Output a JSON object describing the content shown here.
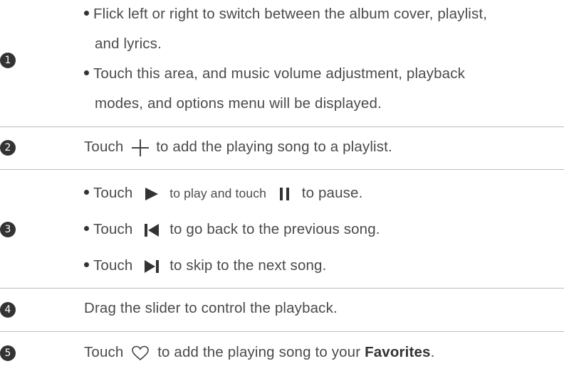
{
  "rows": [
    {
      "number": "1",
      "items": [
        "Flick left or right to switch between the album cover, playlist,",
        "and lyrics.",
        "Touch this area, and music volume adjustment, playback",
        "modes, and options menu will be displayed."
      ]
    },
    {
      "number": "2",
      "pre": "Touch",
      "icon": "plus-icon",
      "post": "to add the playing song to a playlist."
    },
    {
      "number": "3",
      "items": [
        {
          "pre": "Touch",
          "icon": "play-icon",
          "mid": "to play and touch",
          "icon2": "pause-icon",
          "post": "to pause."
        },
        {
          "pre": "Touch",
          "icon": "previous-icon",
          "post": "to go back to the previous song."
        },
        {
          "pre": "Touch",
          "icon": "next-icon",
          "post": "to skip to the next song."
        }
      ]
    },
    {
      "number": "4",
      "text": "Drag the slider to control the playback."
    },
    {
      "number": "5",
      "pre": "Touch",
      "icon": "heart-icon",
      "post": "to add the playing song to your",
      "bold": "Favorites",
      "end": "."
    }
  ]
}
